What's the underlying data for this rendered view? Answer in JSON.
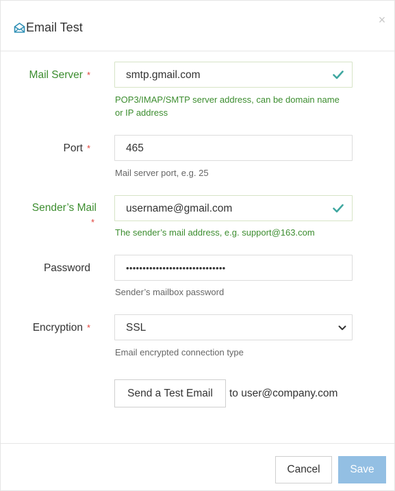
{
  "dialog": {
    "title": "Email Test",
    "title_icon": "envelope-open-icon",
    "close_icon": "close-icon",
    "close_glyph": "×"
  },
  "required_marker": "*",
  "form": {
    "mail_server": {
      "label": "Mail Server",
      "value": "smtp.gmail.com",
      "help": "POP3/IMAP/SMTP server address, can be domain name or IP address",
      "status": "valid"
    },
    "port": {
      "label": "Port",
      "value": "465",
      "help": "Mail server port, e.g. 25"
    },
    "sender_mail": {
      "label": "Sender’s Mail",
      "value": "username@gmail.com",
      "help": "The sender’s mail address, e.g. support@163.com",
      "status": "valid"
    },
    "password": {
      "label": "Password",
      "value": "••••••••••••••••••••••••••••••",
      "help": "Sender’s mailbox password"
    },
    "encryption": {
      "label": "Encryption",
      "value": "SSL",
      "help": "Email encrypted connection type"
    }
  },
  "test": {
    "button_label": "Send a Test Email",
    "target": "to user@company.com"
  },
  "footer": {
    "cancel_label": "Cancel",
    "save_label": "Save"
  },
  "colors": {
    "valid": "#3c8d2f",
    "check": "#3fa7a0",
    "required": "#e0433b",
    "save_bg": "#93bfe3",
    "title_icon": "#2f8fb5"
  }
}
